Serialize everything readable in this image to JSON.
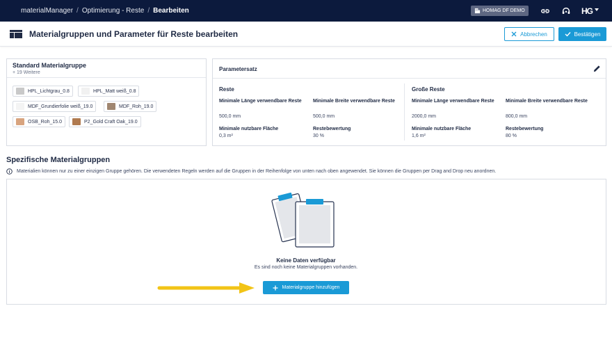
{
  "topbar": {
    "breadcrumbs": [
      "materialManager",
      "Optimierung - Reste",
      "Bearbeiten"
    ],
    "separator": "/",
    "tenant": "HOMAG DF DEMO",
    "brand": "HG"
  },
  "header": {
    "title": "Materialgruppen und Parameter für Reste bearbeiten",
    "cancel_label": "Abbrechen",
    "confirm_label": "Bestätigen"
  },
  "standard_group": {
    "title": "Standard Materialgruppe",
    "subtitle": "+ 19 Weitere",
    "materials": [
      {
        "label": "HPL_Lichtgrau_0.8",
        "color": "#c9c9c9"
      },
      {
        "label": "HPL_Matt weiß_0.8",
        "color": "#f1f1f1"
      },
      {
        "label": "MDF_Grundierfolie weiß_19.0",
        "color": "#f4f4f4"
      },
      {
        "label": "MDF_Roh_19.0",
        "color": "#a08670"
      },
      {
        "label": "OSB_Roh_15.0",
        "color": "#d8a47f"
      },
      {
        "label": "P2_Gold Craft Oak_19.0",
        "color": "#b07a4f"
      }
    ]
  },
  "parameter_set": {
    "title": "Parametersatz",
    "sections": [
      {
        "title": "Reste",
        "fields": [
          {
            "label": "Minimale Länge verwendbare Reste",
            "value": "500,0 mm"
          },
          {
            "label": "Minimale Breite verwendbare Reste",
            "value": "500,0 mm"
          },
          {
            "label": "Minimale nutzbare Fläche",
            "value": "0,3 m²"
          },
          {
            "label": "Restebewertung",
            "value": "30 %"
          }
        ]
      },
      {
        "title": "Große Reste",
        "fields": [
          {
            "label": "Minimale Länge verwendbare Reste",
            "value": "2000,0 mm"
          },
          {
            "label": "Minimale Breite verwendbare Reste",
            "value": "800,0 mm"
          },
          {
            "label": "Minimale nutzbare Fläche",
            "value": "1,6 m²"
          },
          {
            "label": "Restebewertung",
            "value": "80 %"
          }
        ]
      }
    ]
  },
  "specific_groups": {
    "title": "Spezifische Materialgruppen",
    "info": "Materialien können nur zu einer einzigen Gruppe gehören. Die verwendeten Regeln werden auf die Gruppen in der Reihenfolge von unten nach oben angewendet. Sie können die Gruppen per Drag and Drop neu anordnen.",
    "empty_title": "Keine Daten verfügbar",
    "empty_subtitle": "Es sind noch keine Materialgruppen vorhanden.",
    "add_label": "Materialgruppe hinzufügen"
  },
  "colors": {
    "navy": "#0c1a3d",
    "accent": "#1a9ad6",
    "arrow": "#f2c417"
  }
}
